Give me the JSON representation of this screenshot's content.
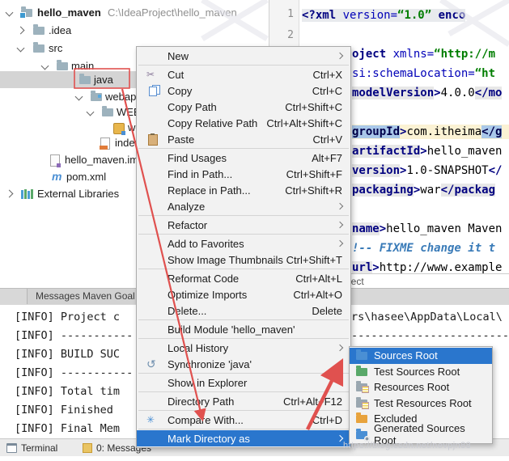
{
  "watermark_text": "https://blog.csdn.net/nevpjn88",
  "project_tree": {
    "rows": [
      {
        "label": "hello_maven",
        "path": "C:\\IdeaProject\\hello_maven"
      },
      {
        "label": ".idea"
      },
      {
        "label": "src"
      },
      {
        "label": "main"
      },
      {
        "label": "java"
      },
      {
        "label": "webapp"
      },
      {
        "label": "WEB-INF"
      },
      {
        "label": "web.xml"
      },
      {
        "label": "index.jsp"
      },
      {
        "label": "hello_maven.iml"
      },
      {
        "label": "pom.xml"
      },
      {
        "label": "External Libraries"
      }
    ]
  },
  "editor": {
    "line_numbers": [
      "1",
      "2"
    ],
    "breadcrumb": "ject",
    "lines": [
      {
        "s": [
          {
            "t": "<?"
          },
          {
            "t": "xml "
          },
          {
            "t": "version="
          },
          {
            "t": "“1.0” "
          },
          {
            "t": "enco"
          }
        ]
      },
      {
        "s": [
          {
            "t": "oject "
          },
          {
            "t": "xmlns="
          },
          {
            "t": "“http://m"
          }
        ]
      },
      {
        "s": [
          {
            "t": "si:schemaLocation="
          },
          {
            "t": "“ht"
          }
        ]
      },
      {
        "s": [
          {
            "t": "modelVersion"
          },
          {
            "t": ">"
          },
          {
            "t": "4.0.0"
          },
          {
            "t": "</mo"
          }
        ]
      },
      {
        "s": [
          {
            "t": "groupId"
          },
          {
            "t": ">"
          },
          {
            "t": "com.itheima"
          },
          {
            "t": "</g"
          }
        ]
      },
      {
        "s": [
          {
            "t": "artifactId"
          },
          {
            "t": ">"
          },
          {
            "t": "hello_maven"
          }
        ]
      },
      {
        "s": [
          {
            "t": "version"
          },
          {
            "t": ">"
          },
          {
            "t": "1.0-SNAPSHOT"
          },
          {
            "t": "</"
          }
        ]
      },
      {
        "s": [
          {
            "t": "packaging"
          },
          {
            "t": ">"
          },
          {
            "t": "war"
          },
          {
            "t": "</packag"
          }
        ]
      },
      {
        "s": [
          {
            "t": "name"
          },
          {
            "t": ">"
          },
          {
            "t": "hello_maven Maven "
          }
        ]
      },
      {
        "s": [
          {
            "t": "!-- "
          },
          {
            "t": "FIXME change it t"
          }
        ]
      },
      {
        "s": [
          {
            "t": "url"
          },
          {
            "t": ">"
          },
          {
            "t": "http://www.example"
          }
        ]
      }
    ]
  },
  "context_menu": {
    "items": [
      {
        "label": "New",
        "shortcut": ""
      },
      {
        "label": "Cut",
        "shortcut": "Ctrl+X"
      },
      {
        "label": "Copy",
        "shortcut": "Ctrl+C"
      },
      {
        "label": "Copy Path",
        "shortcut": "Ctrl+Shift+C"
      },
      {
        "label": "Copy Relative Path",
        "shortcut": "Ctrl+Alt+Shift+C"
      },
      {
        "label": "Paste",
        "shortcut": "Ctrl+V"
      },
      {
        "label": "Find Usages",
        "shortcut": "Alt+F7"
      },
      {
        "label": "Find in Path...",
        "shortcut": "Ctrl+Shift+F"
      },
      {
        "label": "Replace in Path...",
        "shortcut": "Ctrl+Shift+R"
      },
      {
        "label": "Analyze",
        "shortcut": ""
      },
      {
        "label": "Refactor",
        "shortcut": ""
      },
      {
        "label": "Add to Favorites",
        "shortcut": ""
      },
      {
        "label": "Show Image Thumbnails",
        "shortcut": "Ctrl+Shift+T"
      },
      {
        "label": "Reformat Code",
        "shortcut": "Ctrl+Alt+L"
      },
      {
        "label": "Optimize Imports",
        "shortcut": "Ctrl+Alt+O"
      },
      {
        "label": "Delete...",
        "shortcut": "Delete"
      },
      {
        "label": "Build Module 'hello_maven'",
        "shortcut": ""
      },
      {
        "label": "Local History",
        "shortcut": ""
      },
      {
        "label": "Synchronize 'java'",
        "shortcut": ""
      },
      {
        "label": "Show in Explorer",
        "shortcut": ""
      },
      {
        "label": "Directory Path",
        "shortcut": "Ctrl+Alt+F12"
      },
      {
        "label": "Compare With...",
        "shortcut": "Ctrl+D"
      },
      {
        "label": "Mark Directory as",
        "shortcut": ""
      }
    ]
  },
  "submenu": {
    "items": [
      {
        "label": "Sources Root"
      },
      {
        "label": "Test Sources Root"
      },
      {
        "label": "Resources Root"
      },
      {
        "label": "Test Resources Root"
      },
      {
        "label": "Excluded"
      },
      {
        "label": "Generated Sources Root"
      }
    ]
  },
  "messages": {
    "tab": "Messages Maven Goal",
    "left_lines": [
      "[INFO] Project c",
      "[INFO] ----------------",
      "[INFO] BUILD SUC",
      "[INFO] ----------------",
      "[INFO] Total tim",
      "[INFO] Finished ",
      "[INFO] Final Mem"
    ],
    "right_line_1": "rs\\hasee\\AppData\\Local\\",
    "right_line_2": "--------------------------"
  },
  "status_bar": {
    "terminal": "Terminal",
    "messages": "0: Messages"
  }
}
